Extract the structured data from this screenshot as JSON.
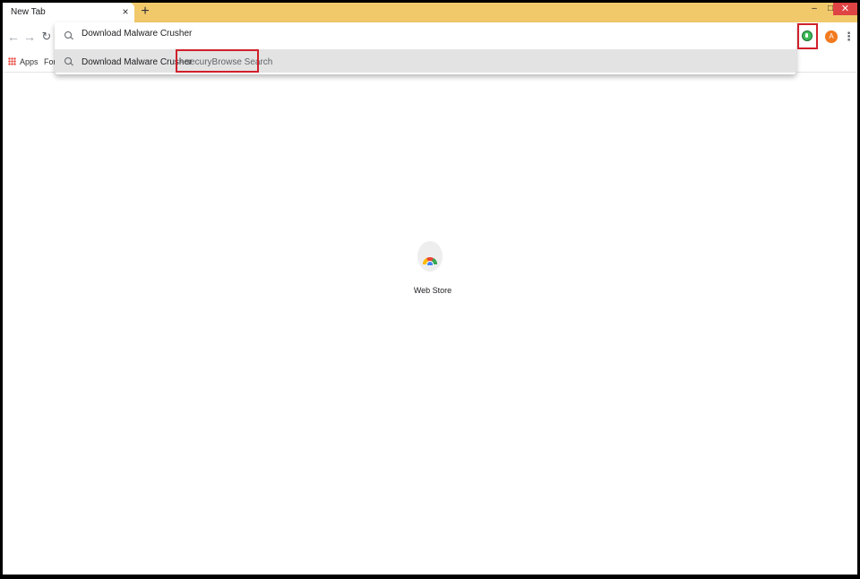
{
  "tabs": [
    {
      "title": "New Tab"
    }
  ],
  "icons": {
    "tab_close": "×",
    "new_tab": "+",
    "minimize": "–",
    "maximize": "□",
    "close": "✕",
    "back": "←",
    "forward": "→",
    "reload": "↻",
    "menu": "⋮"
  },
  "omnibox": {
    "input_value": "Download Malware Crusher",
    "suggestion": {
      "query": "Download Malware Crusher",
      "engine": " - securyBrowse Search"
    }
  },
  "profile": {
    "initial": "A",
    "color": "#f27a1e"
  },
  "extension": {
    "icon": "securybrowse-extension-icon",
    "color": "#3dbb58"
  },
  "bookmarks": {
    "apps_label": "Apps",
    "items": [
      "For"
    ]
  },
  "shortcuts": [
    {
      "label": "Web Store"
    }
  ],
  "highlight_color": "#d0202a",
  "tabstrip_color": "#f1c96b"
}
